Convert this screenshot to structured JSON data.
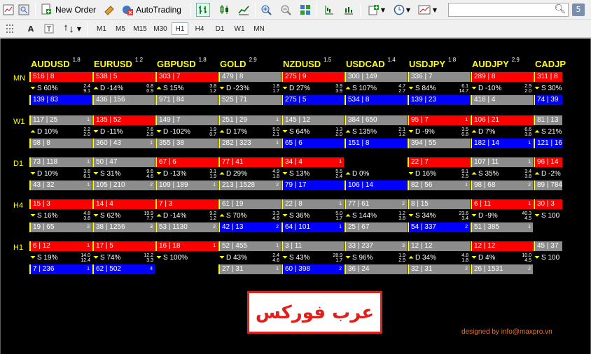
{
  "toolbar": {
    "new_order_label": "New Order",
    "autotrading_label": "AutoTrading",
    "search_placeholder": "",
    "badge_count": "5"
  },
  "timeframes": [
    "M1",
    "M5",
    "M15",
    "M30",
    "H1",
    "H4",
    "D1",
    "W1",
    "MN"
  ],
  "active_timeframe": "H1",
  "colors": {
    "red": "#ff0000",
    "gray": "#8c8c8c",
    "blue": "#0000ff",
    "header_yellow": "#ffff00",
    "credit_orange": "#e8762a",
    "logo_red": "#e0201c"
  },
  "symbols": [
    {
      "name": "AUDUSD",
      "sup": "1.8"
    },
    {
      "name": "EURUSD",
      "sup": "1.2"
    },
    {
      "name": "GBPUSD",
      "sup": "1.8"
    },
    {
      "name": "GOLD",
      "sup": "2.9"
    },
    {
      "name": "NZDUSD",
      "sup": "1.5"
    },
    {
      "name": "USDCAD",
      "sup": "1.4"
    },
    {
      "name": "USDJPY",
      "sup": "1.8"
    },
    {
      "name": "AUDJPY",
      "sup": "2.9"
    },
    {
      "name": "CADJP",
      "sup": ""
    }
  ],
  "rows": [
    {
      "label": "MN",
      "cells": [
        {
          "top": {
            "t": "516 | 8",
            "c": "red",
            "n": ""
          },
          "mid": {
            "arr": "down",
            "t": "S 60%",
            "r1": "2.4",
            "r2": "9.1"
          },
          "bot": {
            "t": "139 | 83",
            "c": "blue",
            "n": ""
          }
        },
        {
          "top": {
            "t": "538 | 5",
            "c": "red",
            "n": ""
          },
          "mid": {
            "arr": "up",
            "t": "D -14%",
            "r1": "0.8",
            "r2": "0.9"
          },
          "bot": {
            "t": "436 | 156",
            "c": "gray",
            "n": ""
          }
        },
        {
          "top": {
            "t": "303 | 7",
            "c": "red",
            "n": ""
          },
          "mid": {
            "arr": "up",
            "t": "S 15%",
            "r1": "3.8",
            "r2": "1.2"
          },
          "bot": {
            "t": "971 | 84",
            "c": "gray",
            "n": ""
          }
        },
        {
          "top": {
            "t": "479 | 8",
            "c": "gray",
            "n": ""
          },
          "mid": {
            "arr": "down",
            "t": "D -23%",
            "r1": "1.8",
            "r2": "1.7"
          },
          "bot": {
            "t": "525 | 71",
            "c": "gray",
            "n": ""
          }
        },
        {
          "top": {
            "t": "275 | 9",
            "c": "red",
            "n": ""
          },
          "mid": {
            "arr": "down",
            "t": "D 27%",
            "r1": "3.9",
            "r2": "3.9"
          },
          "bot": {
            "t": "275 | 5",
            "c": "blue",
            "n": ""
          }
        },
        {
          "top": {
            "t": "300 | 149",
            "c": "gray",
            "n": ""
          },
          "mid": {
            "arr": "up",
            "t": "S 107%",
            "r1": "4.7",
            "r2": "2.7"
          },
          "bot": {
            "t": "534 | 8",
            "c": "blue",
            "n": ""
          }
        },
        {
          "top": {
            "t": "336 | 7",
            "c": "gray",
            "n": ""
          },
          "mid": {
            "arr": "down",
            "t": "S 84%",
            "r1": "6.1",
            "r2": "14.7"
          },
          "bot": {
            "t": "139 | 23",
            "c": "blue",
            "n": ""
          }
        },
        {
          "top": {
            "t": "289 | 8",
            "c": "red",
            "n": ""
          },
          "mid": {
            "arr": "down",
            "t": "D -10%",
            "r1": "2.9",
            "r2": "2.0"
          },
          "bot": {
            "t": "416 | 4",
            "c": "gray",
            "n": ""
          }
        },
        {
          "top": {
            "t": "311 | 8",
            "c": "red",
            "n": ""
          },
          "mid": {
            "arr": "down",
            "t": "S 30%",
            "r1": "",
            "r2": ""
          },
          "bot": {
            "t": "74 | 39",
            "c": "blue",
            "n": ""
          }
        }
      ]
    },
    {
      "label": "W1",
      "cells": [
        {
          "top": {
            "t": "117 | 25",
            "c": "gray",
            "n": "1"
          },
          "mid": {
            "arr": "up",
            "t": "D 10%",
            "r1": "2.2",
            "r2": "2.0"
          },
          "bot": {
            "t": "98 | 8",
            "c": "gray",
            "n": ""
          }
        },
        {
          "top": {
            "t": "135 | 52",
            "c": "red",
            "n": ""
          },
          "mid": {
            "arr": "down",
            "t": "D -11%",
            "r1": "7.6",
            "r2": "2.8"
          },
          "bot": {
            "t": "360 | 43",
            "c": "gray",
            "n": "1"
          }
        },
        {
          "top": {
            "t": "149 | 7",
            "c": "gray",
            "n": ""
          },
          "mid": {
            "arr": "down",
            "t": "D -102%",
            "r1": "1.9",
            "r2": "0.7"
          },
          "bot": {
            "t": "355 | 38",
            "c": "gray",
            "n": ""
          }
        },
        {
          "top": {
            "t": "251 | 29",
            "c": "gray",
            "n": "1"
          },
          "mid": {
            "arr": "up",
            "t": "D 17%",
            "r1": "5.0",
            "r2": "2.1"
          },
          "bot": {
            "t": "282 | 323",
            "c": "gray",
            "n": "1"
          }
        },
        {
          "top": {
            "t": "145 | 12",
            "c": "gray",
            "n": ""
          },
          "mid": {
            "arr": "down",
            "t": "S 64%",
            "r1": "1.3",
            "r2": "2.0"
          },
          "bot": {
            "t": "65 | 6",
            "c": "blue",
            "n": ""
          }
        },
        {
          "top": {
            "t": "384 | 650",
            "c": "gray",
            "n": ""
          },
          "mid": {
            "arr": "up",
            "t": "S 135%",
            "r1": "2.1",
            "r2": "1.2"
          },
          "bot": {
            "t": "151 | 8",
            "c": "blue",
            "n": ""
          }
        },
        {
          "top": {
            "t": "95 | 7",
            "c": "red",
            "n": "1"
          },
          "mid": {
            "arr": "down",
            "t": "D -9%",
            "r1": "3.5",
            "r2": "0.8"
          },
          "bot": {
            "t": "394 | 55",
            "c": "gray",
            "n": ""
          }
        },
        {
          "top": {
            "t": "106 | 21",
            "c": "red",
            "n": ""
          },
          "mid": {
            "arr": "up",
            "t": "D 7%",
            "r1": "6.6",
            "r2": "3.8"
          },
          "bot": {
            "t": "182 | 14",
            "c": "blue",
            "n": "1"
          }
        },
        {
          "top": {
            "t": "81 | 13",
            "c": "gray",
            "n": ""
          },
          "mid": {
            "arr": "up",
            "t": "S 21%",
            "r1": "",
            "r2": ""
          },
          "bot": {
            "t": "121 | 16",
            "c": "blue",
            "n": ""
          }
        }
      ]
    },
    {
      "label": "D1",
      "cells": [
        {
          "top": {
            "t": "73 | 118",
            "c": "gray",
            "n": "1"
          },
          "mid": {
            "arr": "down",
            "t": "D 10%",
            "r1": "3.6",
            "r2": "6.1"
          },
          "bot": {
            "t": "43 | 32",
            "c": "gray",
            "n": "1"
          }
        },
        {
          "top": {
            "t": "50 | 47",
            "c": "gray",
            "n": ""
          },
          "mid": {
            "arr": "down",
            "t": "S 31%",
            "r1": "9.6",
            "r2": "4.6"
          },
          "bot": {
            "t": "105 | 210",
            "c": "gray",
            "n": "2"
          }
        },
        {
          "top": {
            "t": "67 | 6",
            "c": "red",
            "n": ""
          },
          "mid": {
            "arr": "down",
            "t": "D -13%",
            "r1": "3.1",
            "r2": "1.9"
          },
          "bot": {
            "t": "109 | 189",
            "c": "gray",
            "n": "1"
          }
        },
        {
          "top": {
            "t": "77 | 41",
            "c": "red",
            "n": ""
          },
          "mid": {
            "arr": "up",
            "t": "D 29%",
            "r1": "4.9",
            "r2": "1.8"
          },
          "bot": {
            "t": "213 | 1528",
            "c": "gray",
            "n": "2"
          }
        },
        {
          "top": {
            "t": "34 | 4",
            "c": "red",
            "n": "1"
          },
          "mid": {
            "arr": "down",
            "t": "S 13%",
            "r1": "5.5",
            "r2": "2.4"
          },
          "bot": {
            "t": "79 | 17",
            "c": "blue",
            "n": ""
          }
        },
        {
          "top": {
            "t": "",
            "c": "none",
            "n": ""
          },
          "mid": {
            "arr": "up",
            "t": "D 0%",
            "r1": "",
            "r2": ""
          },
          "bot": {
            "t": "106 | 14",
            "c": "blue",
            "n": ""
          }
        },
        {
          "top": {
            "t": "22 | 7",
            "c": "red",
            "n": ""
          },
          "mid": {
            "arr": "down",
            "t": "D 16%",
            "r1": "9.1",
            "r2": "2.5"
          },
          "bot": {
            "t": "82 | 56",
            "c": "gray",
            "n": "1"
          }
        },
        {
          "top": {
            "t": "107 | 11",
            "c": "gray",
            "n": "1"
          },
          "mid": {
            "arr": "up",
            "t": "S 35%",
            "r1": "3.4",
            "r2": "3.8"
          },
          "bot": {
            "t": "98 | 68",
            "c": "gray",
            "n": "2"
          }
        },
        {
          "top": {
            "t": "96 | 14",
            "c": "red",
            "n": ""
          },
          "mid": {
            "arr": "up",
            "t": "D -2%",
            "r1": "",
            "r2": ""
          },
          "bot": {
            "t": "89 | 784",
            "c": "gray",
            "n": ""
          }
        }
      ]
    },
    {
      "label": "H4",
      "cells": [
        {
          "top": {
            "t": "15 | 3",
            "c": "red",
            "n": ""
          },
          "mid": {
            "arr": "down",
            "t": "S 16%",
            "r1": "4.8",
            "r2": "3.8"
          },
          "bot": {
            "t": "19 | 65",
            "c": "gray",
            "n": "2"
          }
        },
        {
          "top": {
            "t": "14 | 4",
            "c": "red",
            "n": ""
          },
          "mid": {
            "arr": "down",
            "t": "S 62%",
            "r1": "19.9",
            "r2": "7.7"
          },
          "bot": {
            "t": "38 | 1256",
            "c": "gray",
            "n": "3"
          }
        },
        {
          "top": {
            "t": "7 | 3",
            "c": "red",
            "n": ""
          },
          "mid": {
            "arr": "up",
            "t": "D -14%",
            "r1": "9.2",
            "r2": "1.2"
          },
          "bot": {
            "t": "53 | 1130",
            "c": "gray",
            "n": "2"
          }
        },
        {
          "top": {
            "t": "61 | 19",
            "c": "gray",
            "n": ""
          },
          "mid": {
            "arr": "up",
            "t": "S 70%",
            "r1": "3.3",
            "r2": "4.9"
          },
          "bot": {
            "t": "42 | 13",
            "c": "blue",
            "n": "2"
          }
        },
        {
          "top": {
            "t": "22 | 8",
            "c": "gray",
            "n": "1"
          },
          "mid": {
            "arr": "down",
            "t": "S 36%",
            "r1": "5.0",
            "r2": "1.7"
          },
          "bot": {
            "t": "64 | 101",
            "c": "blue",
            "n": "1"
          }
        },
        {
          "top": {
            "t": "77 | 61",
            "c": "gray",
            "n": "2"
          },
          "mid": {
            "arr": "up",
            "t": "S 144%",
            "r1": "1.2",
            "r2": "3.8"
          },
          "bot": {
            "t": "25 | 67",
            "c": "gray",
            "n": ""
          }
        },
        {
          "top": {
            "t": "8 | 15",
            "c": "gray",
            "n": ""
          },
          "mid": {
            "arr": "down",
            "t": "S 34%",
            "r1": "23.6",
            "r2": "3.4"
          },
          "bot": {
            "t": "54 | 337",
            "c": "blue",
            "n": "2"
          }
        },
        {
          "top": {
            "t": "6 | 11",
            "c": "red",
            "n": "1"
          },
          "mid": {
            "arr": "down",
            "t": "D -9%",
            "r1": "40.3",
            "r2": "4.5"
          },
          "bot": {
            "t": "51 | 385",
            "c": "gray",
            "n": "1"
          }
        },
        {
          "top": {
            "t": "30 | 3",
            "c": "red",
            "n": ""
          },
          "mid": {
            "arr": "down",
            "t": "S 100",
            "r1": "",
            "r2": ""
          },
          "bot": {
            "t": "",
            "c": "none",
            "n": ""
          }
        }
      ]
    },
    {
      "label": "H1",
      "cells": [
        {
          "top": {
            "t": "6 | 12",
            "c": "red",
            "n": "1"
          },
          "mid": {
            "arr": "down",
            "t": "S 19%",
            "r1": "14.0",
            "r2": "12.4"
          },
          "bot": {
            "t": "7 | 236",
            "c": "blue",
            "n": "1"
          }
        },
        {
          "top": {
            "t": "17 | 5",
            "c": "red",
            "n": ""
          },
          "mid": {
            "arr": "down",
            "t": "S 74%",
            "r1": "12.2",
            "r2": "3.3"
          },
          "bot": {
            "t": "62 | 502",
            "c": "blue",
            "n": "4"
          }
        },
        {
          "top": {
            "t": "16 | 18",
            "c": "red",
            "n": "1"
          },
          "mid": {
            "arr": "down",
            "t": "S 100%",
            "r1": "",
            "r2": ""
          },
          "bot": {
            "t": "",
            "c": "none",
            "n": ""
          }
        },
        {
          "top": {
            "t": "52 | 455",
            "c": "gray",
            "n": "1"
          },
          "mid": {
            "arr": "down",
            "t": "D 43%",
            "r1": "2.4",
            "r2": "4.6"
          },
          "bot": {
            "t": "27 | 31",
            "c": "gray",
            "n": "1"
          }
        },
        {
          "top": {
            "t": "3 | 11",
            "c": "gray",
            "n": ""
          },
          "mid": {
            "arr": "down",
            "t": "S 43%",
            "r1": "28.9",
            "r2": "1.7"
          },
          "bot": {
            "t": "60 | 398",
            "c": "blue",
            "n": "2"
          }
        },
        {
          "top": {
            "t": "33 | 237",
            "c": "gray",
            "n": "3"
          },
          "mid": {
            "arr": "down",
            "t": "S 96%",
            "r1": "1.9",
            "r2": "2.9"
          },
          "bot": {
            "t": "36 | 24",
            "c": "gray",
            "n": ""
          }
        },
        {
          "top": {
            "t": "12 | 12",
            "c": "gray",
            "n": ""
          },
          "mid": {
            "arr": "up",
            "t": "D 34%",
            "r1": "4.8",
            "r2": "1.8"
          },
          "bot": {
            "t": "32 | 31",
            "c": "gray",
            "n": "2"
          }
        },
        {
          "top": {
            "t": "12 | 12",
            "c": "red",
            "n": ""
          },
          "mid": {
            "arr": "down",
            "t": "D 4%",
            "r1": "10.0",
            "r2": "4.5"
          },
          "bot": {
            "t": "26 | 1531",
            "c": "gray",
            "n": "2"
          }
        },
        {
          "top": {
            "t": "45 | 37",
            "c": "gray",
            "n": ""
          },
          "mid": {
            "arr": "down",
            "t": "S 100",
            "r1": "",
            "r2": ""
          },
          "bot": {
            "t": "",
            "c": "none",
            "n": ""
          }
        }
      ]
    }
  ],
  "logo_text": "عرب فوركس",
  "credit": "designed by info@maxpro.vn"
}
